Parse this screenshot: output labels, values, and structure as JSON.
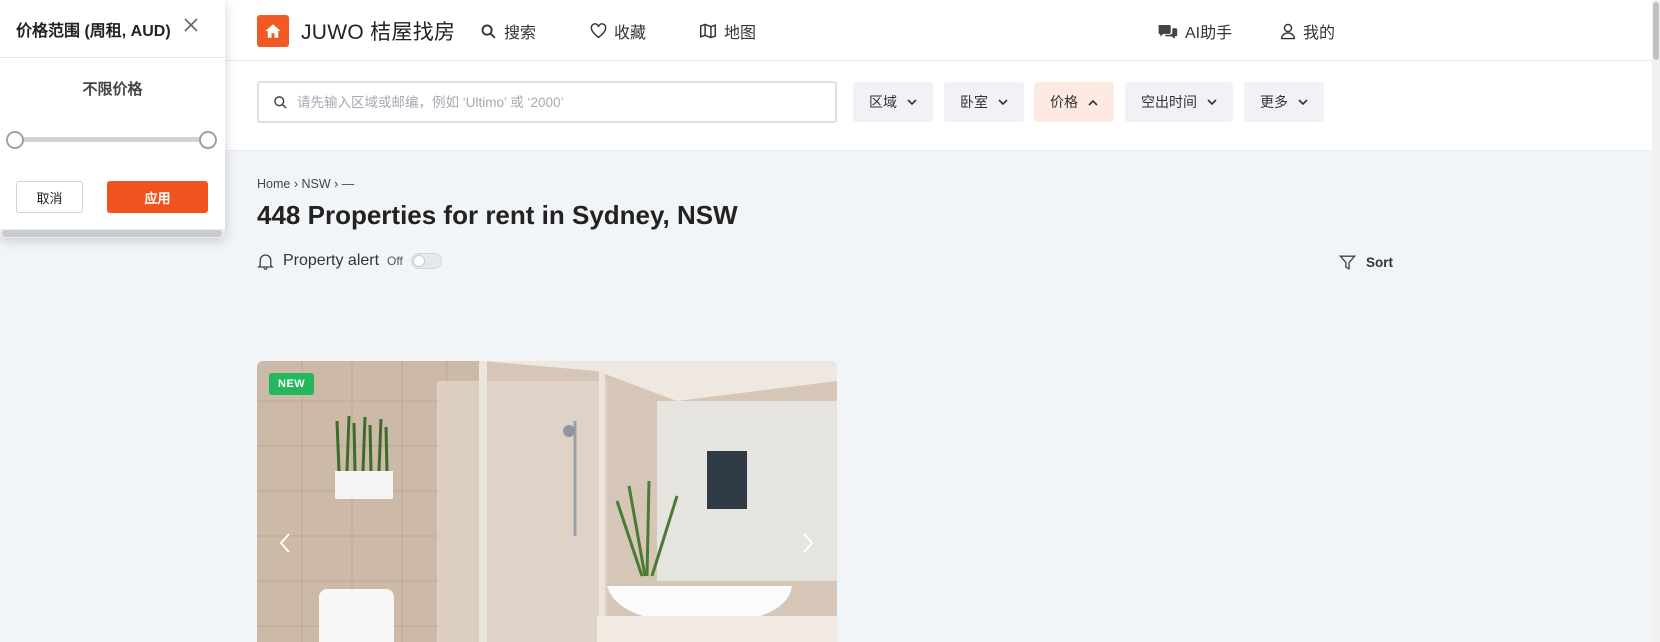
{
  "brand": {
    "name": "JUWO 桔屋找房",
    "color": "#f15a24"
  },
  "nav": {
    "search": "搜索",
    "favorites": "收藏",
    "map": "地图",
    "ai": "AI助手",
    "me": "我的"
  },
  "search": {
    "placeholder": "请先输入区域或邮编，例如 ‘Ultimo’ 或 ‘2000’",
    "value": ""
  },
  "filters": [
    {
      "label": "区域",
      "active": false
    },
    {
      "label": "卧室",
      "active": false
    },
    {
      "label": "价格",
      "active": true
    },
    {
      "label": "空出时间",
      "active": false
    },
    {
      "label": "更多",
      "active": false
    }
  ],
  "breadcrumb": "Home › NSW › —",
  "page_title": "448 Properties for rent in Sydney, NSW",
  "alert": {
    "label": "Property alert",
    "state": "Off"
  },
  "sort_label": "Sort",
  "listing": {
    "badge": "NEW",
    "badge_color": "#22b85b"
  },
  "price_popup": {
    "title": "价格范围 (周租, AUD)",
    "subtitle": "不限价格",
    "range_min": 0,
    "range_max": 1,
    "cancel": "取消",
    "apply": "应用",
    "apply_color": "#f1531e"
  }
}
